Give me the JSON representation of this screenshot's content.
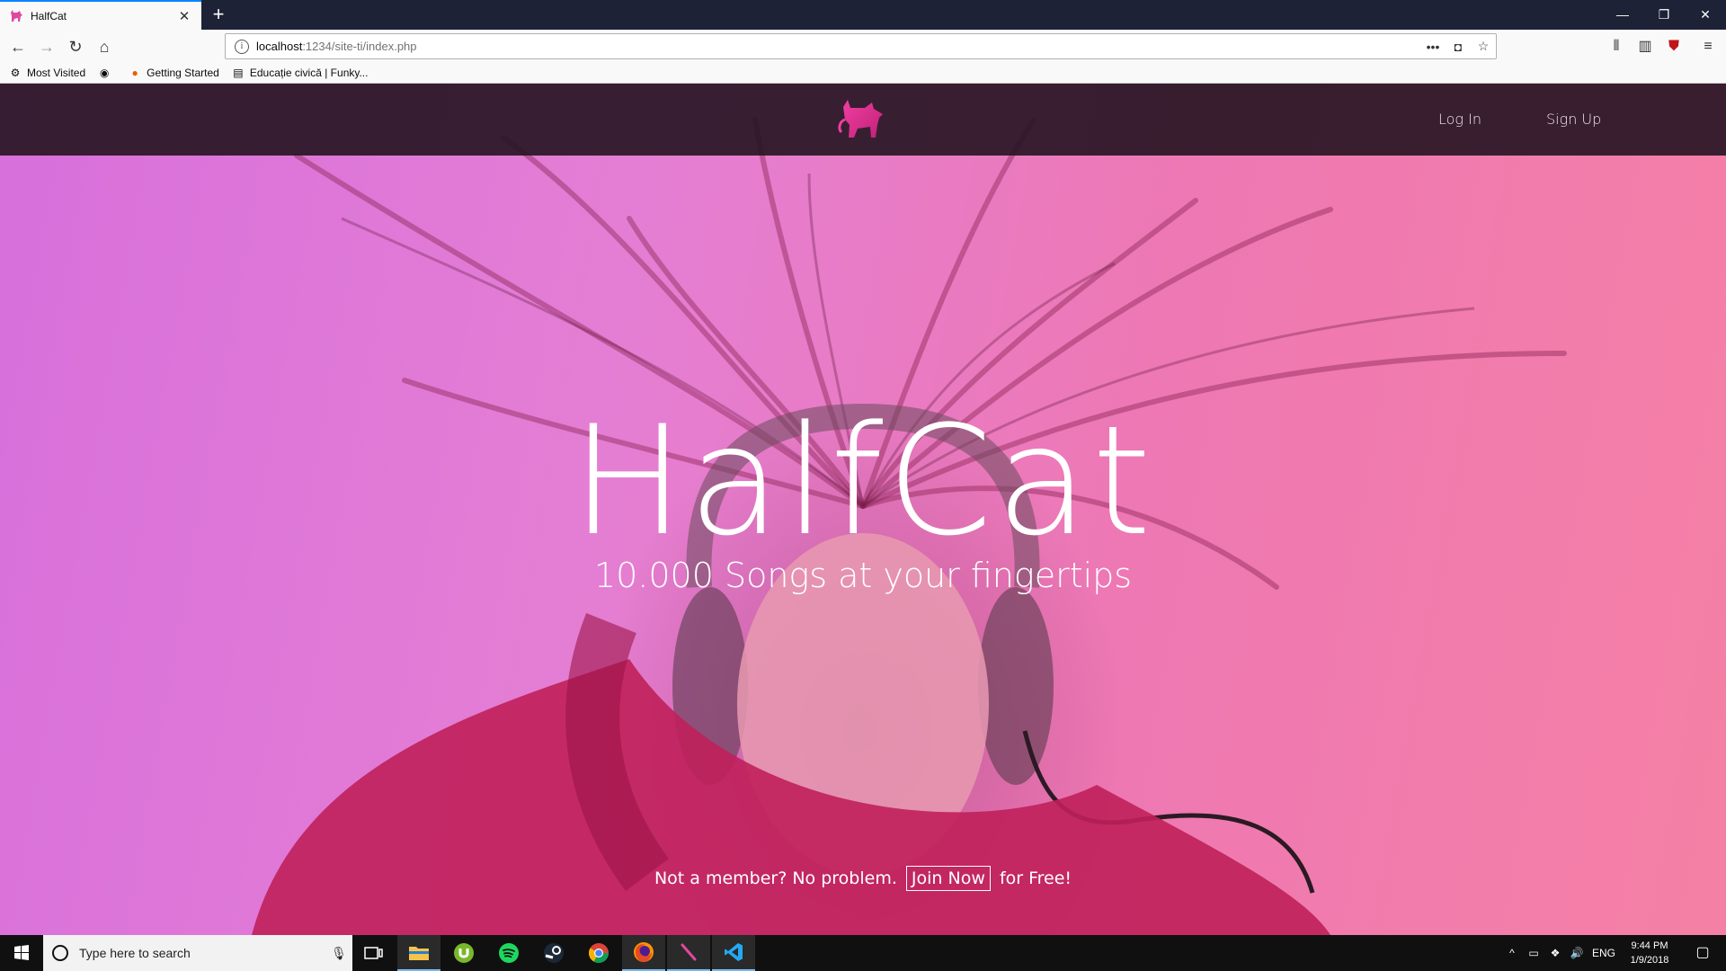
{
  "browser": {
    "tab_title": "HalfCat",
    "url_host": "localhost",
    "url_rest": ":1234/site-ti/index.php",
    "bookmarks": [
      {
        "label": "Most Visited",
        "icon": "gear-icon"
      },
      {
        "label": "",
        "icon": "globe-icon"
      },
      {
        "label": "Getting Started",
        "icon": "firefox-icon"
      },
      {
        "label": "Educație civică | Funky...",
        "icon": "page-icon"
      }
    ]
  },
  "site": {
    "nav": {
      "login": "Log In",
      "signup": "Sign Up"
    },
    "title": "HalfCat",
    "subtitle": "10.000 Songs at your fingertips",
    "cta_before": "Not a member? No problem.",
    "cta_link": "Join Now",
    "cta_after": "for Free!",
    "accent_color": "#e0489c"
  },
  "taskbar": {
    "search_placeholder": "Type here to search",
    "lang": "ENG",
    "time": "9:44 PM",
    "date": "1/9/2018",
    "apps": [
      "task-view-icon",
      "file-explorer-icon",
      "utorrent-icon",
      "spotify-icon",
      "steam-icon",
      "chrome-icon",
      "firefox-icon",
      "pen-app-icon",
      "vscode-icon"
    ]
  }
}
